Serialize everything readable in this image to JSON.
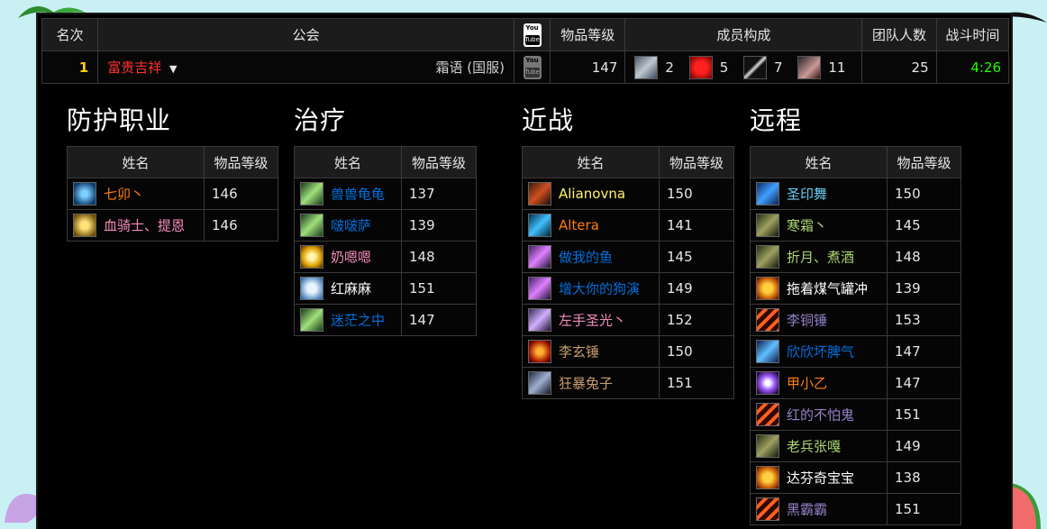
{
  "header": {
    "rank": "名次",
    "guild": "公会",
    "video": "YouTube",
    "item_level": "物品等级",
    "composition": "成员构成",
    "raid_size": "团队人数",
    "fight_time": "战斗时间"
  },
  "row": {
    "rank": "1",
    "guild_name": "富贵吉祥",
    "realm": "霜语 (国服)",
    "item_level": "147",
    "tank_count": "2",
    "healer_count": "5",
    "melee_count": "7",
    "ranged_count": "11",
    "raid_size": "25",
    "fight_time": "4:26"
  },
  "sections": [
    {
      "title": "防护职业",
      "name_header": "姓名",
      "ilvl_header": "物品等级",
      "rows": [
        {
          "name": "七卯丶",
          "ilvl": "146",
          "color": "#ff7d0a",
          "icon": "druid-guardian-icon"
        },
        {
          "name": "血骑士、提恩",
          "ilvl": "146",
          "color": "#f58cba",
          "icon": "paladin-protection-icon"
        }
      ]
    },
    {
      "title": "治疗",
      "name_header": "姓名",
      "ilvl_header": "物品等级",
      "rows": [
        {
          "name": "兽兽龟龟",
          "ilvl": "137",
          "color": "#0070de",
          "icon": "shaman-restoration-icon"
        },
        {
          "name": "啵啵萨",
          "ilvl": "139",
          "color": "#0070de",
          "icon": "shaman-restoration-icon"
        },
        {
          "name": "奶嗯嗯",
          "ilvl": "148",
          "color": "#f58cba",
          "icon": "paladin-holy-icon"
        },
        {
          "name": "红麻麻",
          "ilvl": "151",
          "color": "#ffffff",
          "icon": "priest-discipline-icon"
        },
        {
          "name": "迷茫之中",
          "ilvl": "147",
          "color": "#0070de",
          "icon": "shaman-restoration-icon"
        }
      ]
    },
    {
      "title": "近战",
      "name_header": "姓名",
      "ilvl_header": "物品等级",
      "rows": [
        {
          "name": "Alianovna",
          "ilvl": "150",
          "color": "#fff569",
          "icon": "rogue-icon"
        },
        {
          "name": "Altera",
          "ilvl": "141",
          "color": "#ff7d0a",
          "icon": "druid-feral-icon"
        },
        {
          "name": "做我的鱼",
          "ilvl": "145",
          "color": "#0070de",
          "icon": "shaman-enhancement-icon"
        },
        {
          "name": "增大你的狗演",
          "ilvl": "149",
          "color": "#0070de",
          "icon": "shaman-enhancement-icon"
        },
        {
          "name": "左手圣光丶",
          "ilvl": "152",
          "color": "#f58cba",
          "icon": "paladin-retribution-icon"
        },
        {
          "name": "李玄锤",
          "ilvl": "150",
          "color": "#c79c6e",
          "icon": "warrior-fury-icon"
        },
        {
          "name": "狂暴兔子",
          "ilvl": "151",
          "color": "#c79c6e",
          "icon": "warrior-arms-icon"
        }
      ]
    },
    {
      "title": "远程",
      "name_header": "姓名",
      "ilvl_header": "物品等级",
      "rows": [
        {
          "name": "圣印舞",
          "ilvl": "150",
          "color": "#69ccf0",
          "icon": "mage-frost-icon"
        },
        {
          "name": "寒霜丶",
          "ilvl": "145",
          "color": "#abd473",
          "icon": "hunter-icon"
        },
        {
          "name": "折月、煮酒",
          "ilvl": "148",
          "color": "#abd473",
          "icon": "hunter-icon"
        },
        {
          "name": "拖着煤气罐冲",
          "ilvl": "139",
          "color": "#ffffff",
          "icon": "priest-shadow-icon"
        },
        {
          "name": "李铜锤",
          "ilvl": "153",
          "color": "#9482c9",
          "icon": "warlock-icon"
        },
        {
          "name": "欣欣坏脾气",
          "ilvl": "147",
          "color": "#0070de",
          "icon": "shaman-elemental-icon"
        },
        {
          "name": "甲小乙",
          "ilvl": "147",
          "color": "#ff7d0a",
          "icon": "druid-balance-icon"
        },
        {
          "name": "红的不怕鬼",
          "ilvl": "151",
          "color": "#9482c9",
          "icon": "warlock-icon"
        },
        {
          "name": "老兵张嘎",
          "ilvl": "149",
          "color": "#abd473",
          "icon": "hunter-icon"
        },
        {
          "name": "达芬奇宝宝",
          "ilvl": "138",
          "color": "#ffffff",
          "icon": "priest-shadow-icon"
        },
        {
          "name": "黑霸霸",
          "ilvl": "151",
          "color": "#9482c9",
          "icon": "warlock-icon"
        }
      ]
    }
  ],
  "colors": {
    "guild_name": "#ff3030",
    "rank": "#ffd100",
    "fight_time": "#1eff00"
  }
}
